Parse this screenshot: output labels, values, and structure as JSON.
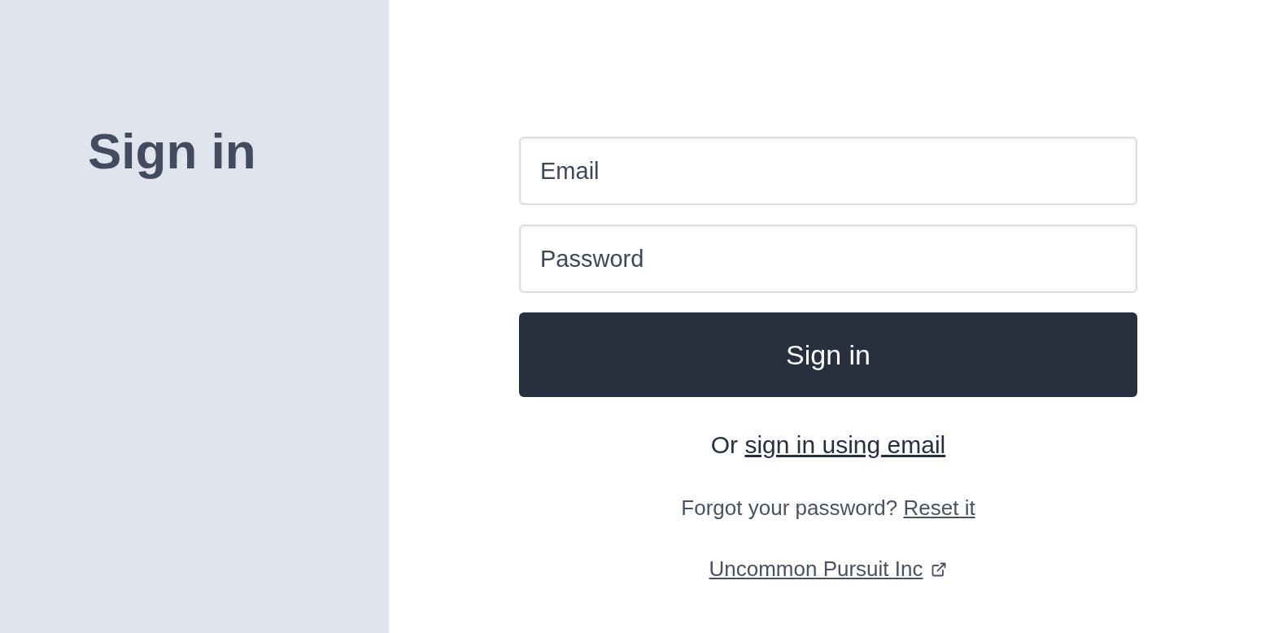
{
  "sidebar": {
    "title": "Sign in"
  },
  "form": {
    "email": {
      "placeholder": "Email"
    },
    "password": {
      "placeholder": "Password"
    },
    "submit": "Sign in",
    "alternative": {
      "prefix": "Or ",
      "link": "sign in using email"
    },
    "forgot": {
      "prefix": "Forgot your password? ",
      "link": "Reset it"
    },
    "company_link": "Uncommon Pursuit Inc"
  }
}
